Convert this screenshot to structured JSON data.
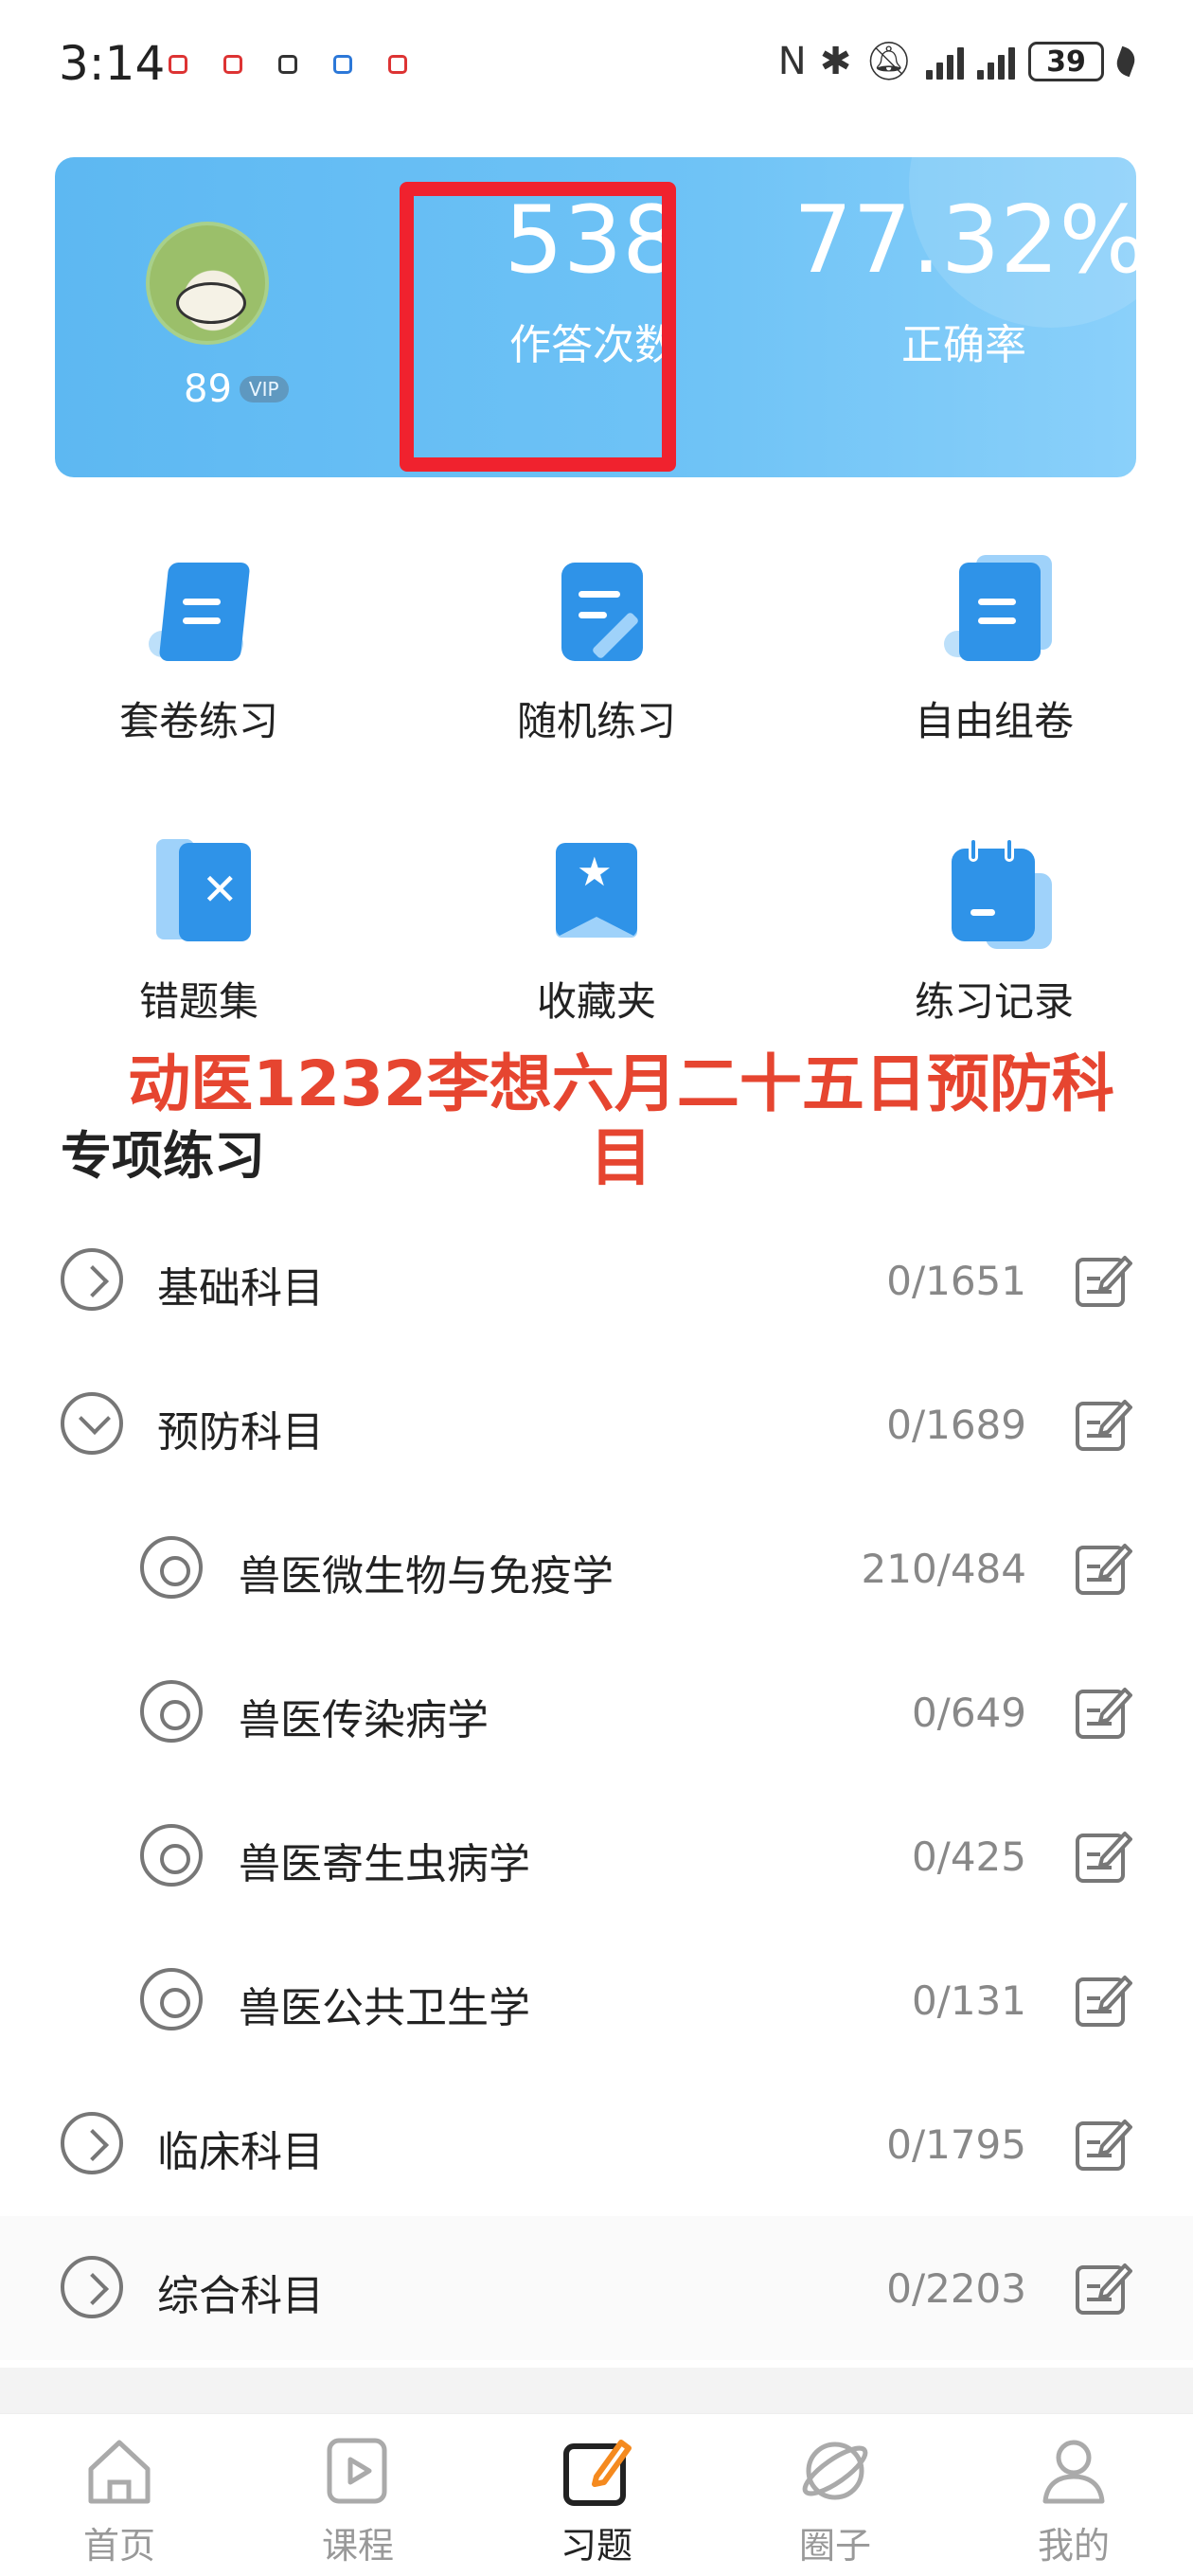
{
  "status_bar": {
    "time": "3:14",
    "battery": "39",
    "icons": [
      "nfc-icon",
      "bluetooth-icon",
      "mute-icon",
      "signal-icon",
      "signal-icon",
      "battery-icon",
      "leaf-icon"
    ]
  },
  "stats": {
    "level": "89",
    "vip_badge": "VIP",
    "answer_count": "538",
    "answer_count_label": "作答次数",
    "accuracy": "77.32%",
    "accuracy_label": "正确率"
  },
  "grid": [
    {
      "label": "套卷练习",
      "icon": "paper-set-icon"
    },
    {
      "label": "随机练习",
      "icon": "random-practice-icon"
    },
    {
      "label": "自由组卷",
      "icon": "custom-paper-icon"
    },
    {
      "label": "错题集",
      "icon": "wrong-questions-icon"
    },
    {
      "label": "收藏夹",
      "icon": "favorites-icon"
    },
    {
      "label": "练习记录",
      "icon": "practice-record-icon"
    }
  ],
  "watermark": "动医1232李想六月二十五日预防科目",
  "section": {
    "title": "专项练习",
    "rows": [
      {
        "label": "基础科目",
        "count": "0/1651"
      },
      {
        "label": "预防科目",
        "count": "0/1689"
      },
      {
        "label": "兽医微生物与免疫学",
        "count": "210/484"
      },
      {
        "label": "兽医传染病学",
        "count": "0/649"
      },
      {
        "label": "兽医寄生虫病学",
        "count": "0/425"
      },
      {
        "label": "兽医公共卫生学",
        "count": "0/131"
      },
      {
        "label": "临床科目",
        "count": "0/1795"
      },
      {
        "label": "综合科目",
        "count": "0/2203"
      }
    ]
  },
  "bottom_nav": [
    {
      "label": "首页",
      "icon": "home-icon"
    },
    {
      "label": "课程",
      "icon": "course-icon"
    },
    {
      "label": "习题",
      "icon": "exercise-icon"
    },
    {
      "label": "圈子",
      "icon": "circle-icon"
    },
    {
      "label": "我的",
      "icon": "profile-icon"
    }
  ],
  "colors": {
    "accent": "#2f93e8",
    "highlight": "#f0222e",
    "watermark": "#e64530"
  }
}
